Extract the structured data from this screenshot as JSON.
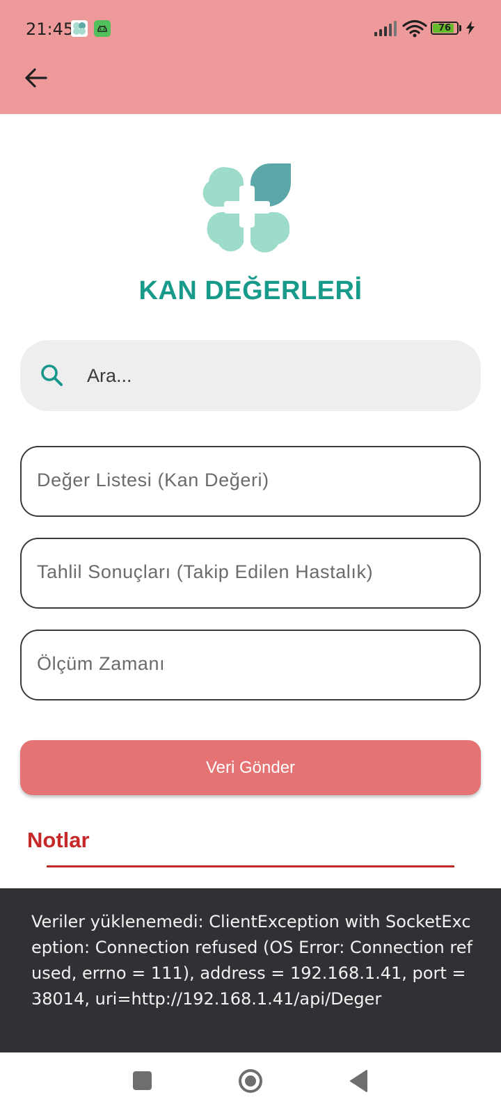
{
  "status_bar": {
    "time": "21:45",
    "battery_level": "76",
    "icons": [
      "clover-notification-icon",
      "android-notification-icon",
      "signal-icon",
      "wifi-icon",
      "battery-icon",
      "charging-bolt-icon"
    ]
  },
  "app_bar": {
    "back_icon": "arrow-back-icon",
    "background_color": "#ef9a9a"
  },
  "header": {
    "title": "KAN DEĞERLERİ",
    "logo_icon": "clover-plus-logo",
    "title_color": "#179a8a"
  },
  "search": {
    "placeholder": "Ara...",
    "value": ""
  },
  "form": {
    "fields": [
      {
        "label": "Değer Listesi (Kan Değeri)",
        "value": ""
      },
      {
        "label": "Tahlil Sonuçları (Takip Edilen Hastalık)",
        "value": ""
      },
      {
        "label": "Ölçüm Zamanı",
        "value": ""
      }
    ],
    "submit_label": "Veri Gönder",
    "submit_color": "#e57373"
  },
  "notes": {
    "title": "Notlar",
    "color": "#c62828"
  },
  "snackbar": {
    "message": "Veriler yüklenemedi: ClientException with SocketException: Connection refused (OS Error: Connection refused, errno = 111), address = 192.168.1.41, port = 38014, uri=http://192.168.1.41/api/Deger"
  },
  "nav_bar": {
    "icons": [
      "recents-square-icon",
      "home-circle-icon",
      "back-triangle-icon"
    ]
  }
}
